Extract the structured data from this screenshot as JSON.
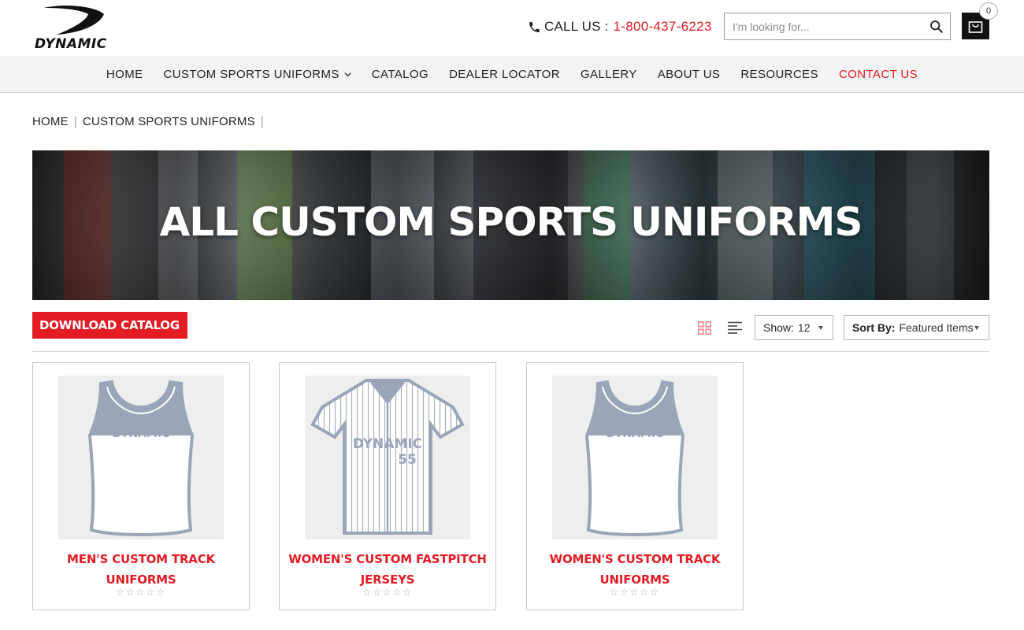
{
  "header": {
    "logo_text": "DYNAMIC",
    "call_label": "CALL US :",
    "phone_number": "1-800-437-6223",
    "search_placeholder": "I'm looking for...",
    "cart_count": "0"
  },
  "nav": {
    "items": [
      {
        "label": "HOME"
      },
      {
        "label": "CUSTOM SPORTS UNIFORMS"
      },
      {
        "label": "CATALOG"
      },
      {
        "label": "DEALER LOCATOR"
      },
      {
        "label": "GALLERY"
      },
      {
        "label": "ABOUT US"
      },
      {
        "label": "RESOURCES"
      },
      {
        "label": "CONTACT US"
      }
    ]
  },
  "breadcrumb": {
    "items": [
      "HOME",
      "CUSTOM SPORTS UNIFORMS"
    ],
    "separator": "|"
  },
  "banner": {
    "title": "ALL CUSTOM SPORTS UNIFORMS"
  },
  "toolbar": {
    "download_label": "DOWNLOAD CATALOG",
    "show_label": "Show:",
    "show_value": "12",
    "sort_label": "Sort By:",
    "sort_value": "Featured Items"
  },
  "products": [
    {
      "name_line1": "MEN'S CUSTOM TRACK",
      "name_line2": "UNIFORMS",
      "rating": "☆☆☆☆☆",
      "graphic_text": "DYNAMIC"
    },
    {
      "name_line1": "WOMEN'S CUSTOM FASTPITCH",
      "name_line2": "JERSEYS",
      "rating": "☆☆☆☆☆",
      "graphic_text": "DYNAMIC",
      "graphic_number": "55"
    },
    {
      "name_line1": "WOMEN'S CUSTOM TRACK",
      "name_line2": "UNIFORMS",
      "rating": "☆☆☆☆☆",
      "graphic_text": "DYNAMIC"
    }
  ],
  "colors": {
    "accent": "#e31b23",
    "nav_bg": "#f3f3f3",
    "jersey_trim": "#9aa6b8"
  }
}
